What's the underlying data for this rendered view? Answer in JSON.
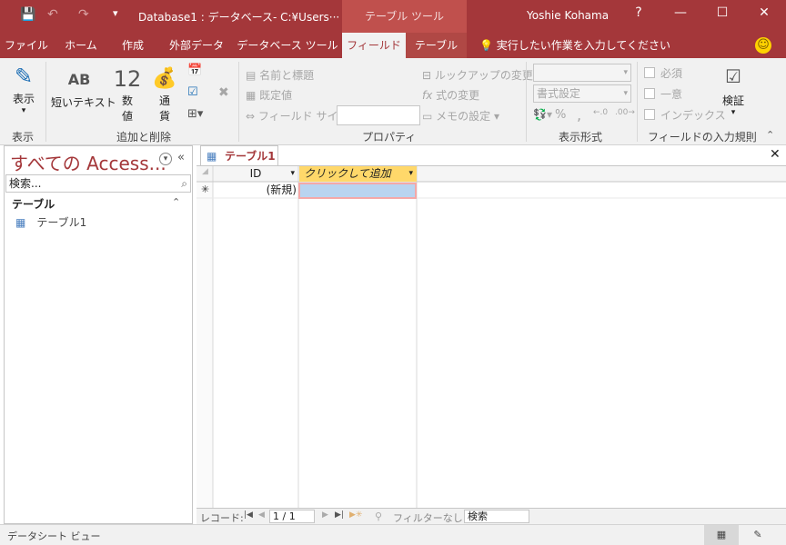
{
  "titlebar": {
    "title": "Database1 : データベース- C:¥Users···",
    "context_tools": "テーブル ツール",
    "user": "Yoshie Kohama",
    "help": "?",
    "minimize": "—",
    "maximize": "☐",
    "close": "✕"
  },
  "tabs": [
    "ファイル",
    "ホーム",
    "作成",
    "外部データ",
    "データベース ツール",
    "フィールド",
    "テーブル"
  ],
  "tellme": "実行したい作業を入力してください",
  "ribbon": {
    "view": {
      "label": "表示",
      "group": "表示"
    },
    "add": {
      "short_text": "短いテキスト",
      "number_1": "数",
      "number_2": "値",
      "currency_1": "通",
      "currency_2": "貨",
      "group": "追加と削除",
      "ab": "AB",
      "twelve": "12"
    },
    "props": {
      "name_caption": "名前と標題",
      "default_value": "既定値",
      "field_size": "フィールド サイズ",
      "lookup": "ルックアップの変更",
      "expression": "式の変更",
      "memo": "メモの設定",
      "group": "プロパティ"
    },
    "format": {
      "format_label": "書式設定",
      "percent": "%",
      "comma": ",",
      "group": "表示形式"
    },
    "validation": {
      "required": "必須",
      "unique": "一意",
      "indexed": "インデックス",
      "validate": "検証",
      "group": "フィールドの入力規則"
    }
  },
  "nav": {
    "title": "すべての Access...",
    "search_placeholder": "検索...",
    "section": "テーブル",
    "item": "テーブル1"
  },
  "doc": {
    "tab": "テーブル1",
    "headers": [
      "ID",
      "クリックして追加"
    ],
    "new_row": "(新規)",
    "record_label": "レコード:",
    "record_pos": "1 / 1",
    "filter": "フィルターなし",
    "search": "検索"
  },
  "statusbar": {
    "view": "データシート ビュー"
  },
  "colors": {
    "accent": "#a4373a",
    "context": "#c0504d",
    "header_yellow": "#ffd86a",
    "cell_blue": "#b9d4f0"
  }
}
